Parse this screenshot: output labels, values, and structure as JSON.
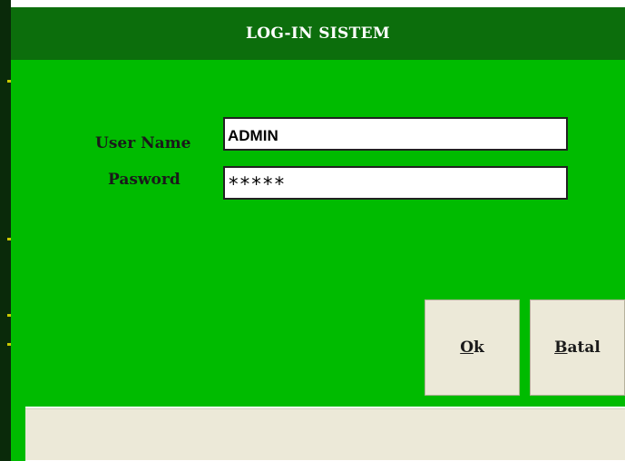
{
  "window": {
    "title": "LOG-IN SISTEM"
  },
  "form": {
    "username_label": "User Name",
    "username_value": "ADMIN",
    "password_label": "Pasword",
    "password_value": "*****"
  },
  "buttons": {
    "ok_accel": "O",
    "ok_rest": "k",
    "cancel_accel": "B",
    "cancel_rest": "atal"
  },
  "colors": {
    "form_background": "#00bb00",
    "title_background": "#0c6e0c",
    "button_background": "#ece9d8"
  }
}
